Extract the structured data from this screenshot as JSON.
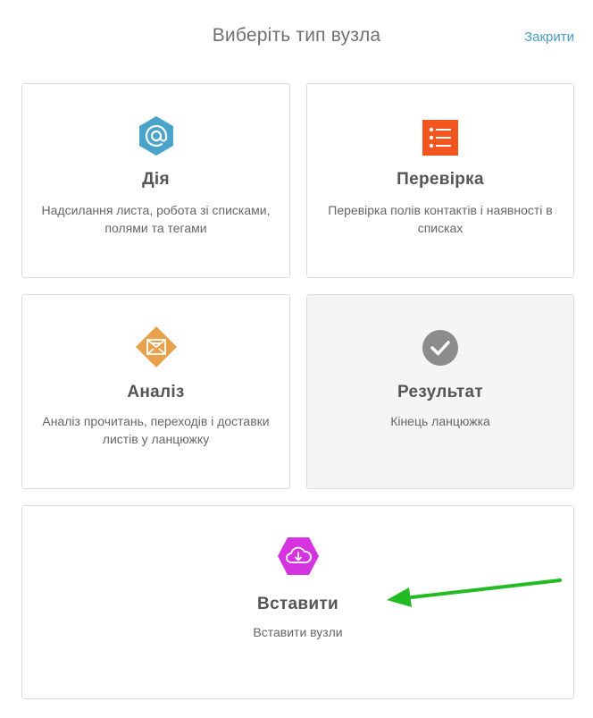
{
  "header": {
    "title": "Виберіть тип вузла",
    "close_label": "Закрити"
  },
  "cards": {
    "action": {
      "title": "Дія",
      "description": "Надсилання листа, робота зі списками, полями та тегами",
      "icon": "at-sign-icon",
      "color": "#4aa3c8"
    },
    "check": {
      "title": "Перевірка",
      "description": "Перевірка полів контактів і наявності в списках",
      "icon": "checklist-icon",
      "color": "#f2551e"
    },
    "analysis": {
      "title": "Аналіз",
      "description": "Аналіз прочитань, переходів і доставки листів у ланцюжку",
      "icon": "envelope-icon",
      "color": "#e8a04a"
    },
    "result": {
      "title": "Результат",
      "description": "Кінець ланцюжка",
      "icon": "checkmark-icon",
      "color": "#8c8c8c"
    },
    "paste": {
      "title": "Вставити",
      "description": "Вставити вузли",
      "icon": "cloud-download-icon",
      "color": "#d633e0"
    }
  },
  "annotation": {
    "arrow_color": "#22bb22"
  }
}
